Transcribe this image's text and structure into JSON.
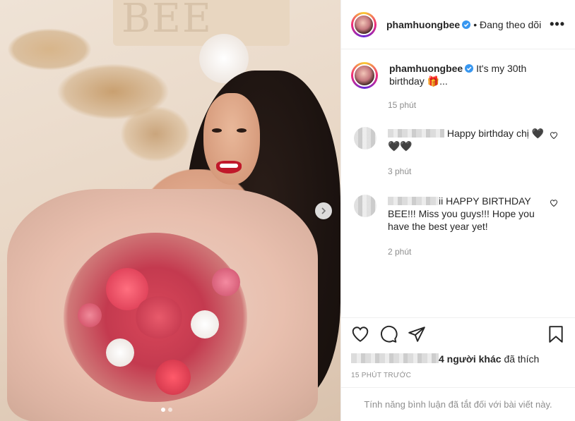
{
  "post": {
    "username": "phamhuongbee",
    "follow_status": "• Đang theo dõi",
    "more_icon": "more-options-icon"
  },
  "caption": {
    "username": "phamhuongbee",
    "text": "It's my 30th birthday 🎁...",
    "time": "15 phút"
  },
  "comments": [
    {
      "text": "Happy birthday chị 🖤🖤🖤",
      "time": "3 phút"
    },
    {
      "text": "ii HAPPY BIRTHDAY BEE!!! Miss you guys!!! Hope you have the best year yet!",
      "time": "2 phút"
    }
  ],
  "likes": {
    "suffix": "4 người khác",
    "verb": "đã thích",
    "ago": "15 PHÚT TRƯỚC"
  },
  "footer": {
    "comments_disabled": "Tính năng bình luận đã tắt đối với bài viết này."
  },
  "colors": {
    "verified": "#3897f0",
    "muted": "#8e8e8e",
    "text": "#262626"
  }
}
